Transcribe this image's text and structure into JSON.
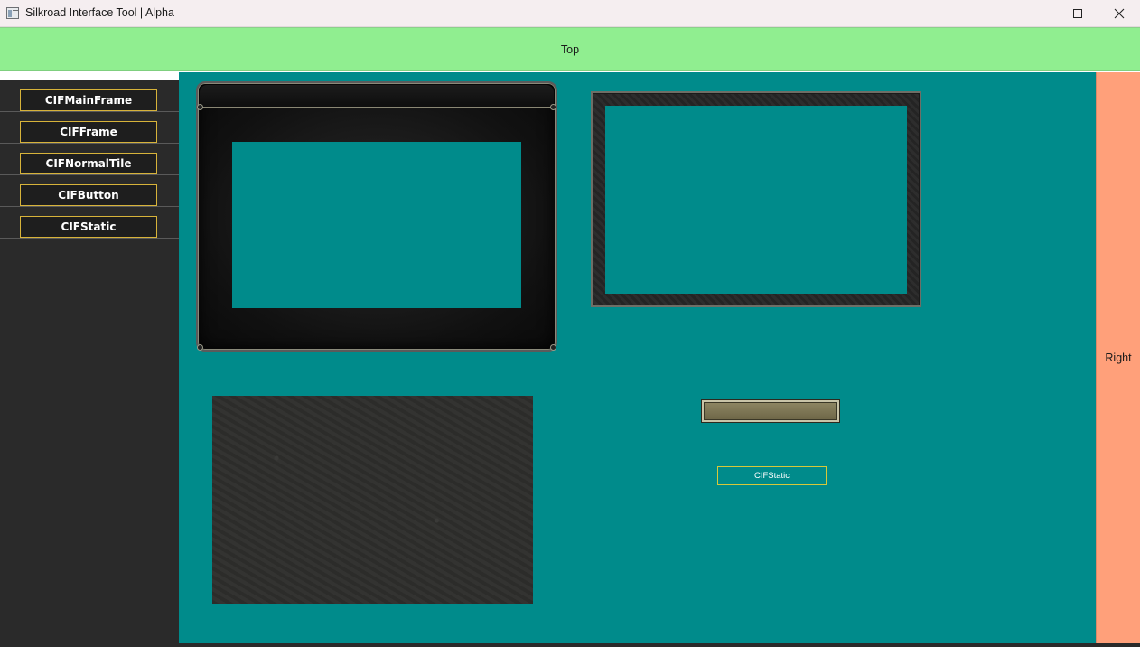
{
  "window": {
    "title": "Silkroad Interface Tool | Alpha",
    "icon": "app-window-icon",
    "controls": {
      "minimize": "minimize-icon",
      "maximize": "maximize-icon",
      "close": "close-icon"
    }
  },
  "layout": {
    "top_label": "Top",
    "right_label": "Right"
  },
  "sidebar": {
    "items": [
      {
        "label": "CIFMainFrame"
      },
      {
        "label": "CIFFrame"
      },
      {
        "label": "CIFNormalTile"
      },
      {
        "label": "CIFButton"
      },
      {
        "label": "CIFStatic"
      }
    ]
  },
  "canvas": {
    "static_label": "CIFStatic",
    "colors": {
      "canvas_bg": "#008B8B",
      "top_band": "#90EE90",
      "right_band": "#FFA07A",
      "sidebar_bg": "#2A2A2A",
      "sidebar_button_border": "#D7B33A",
      "static_border": "#D6C83A"
    }
  }
}
